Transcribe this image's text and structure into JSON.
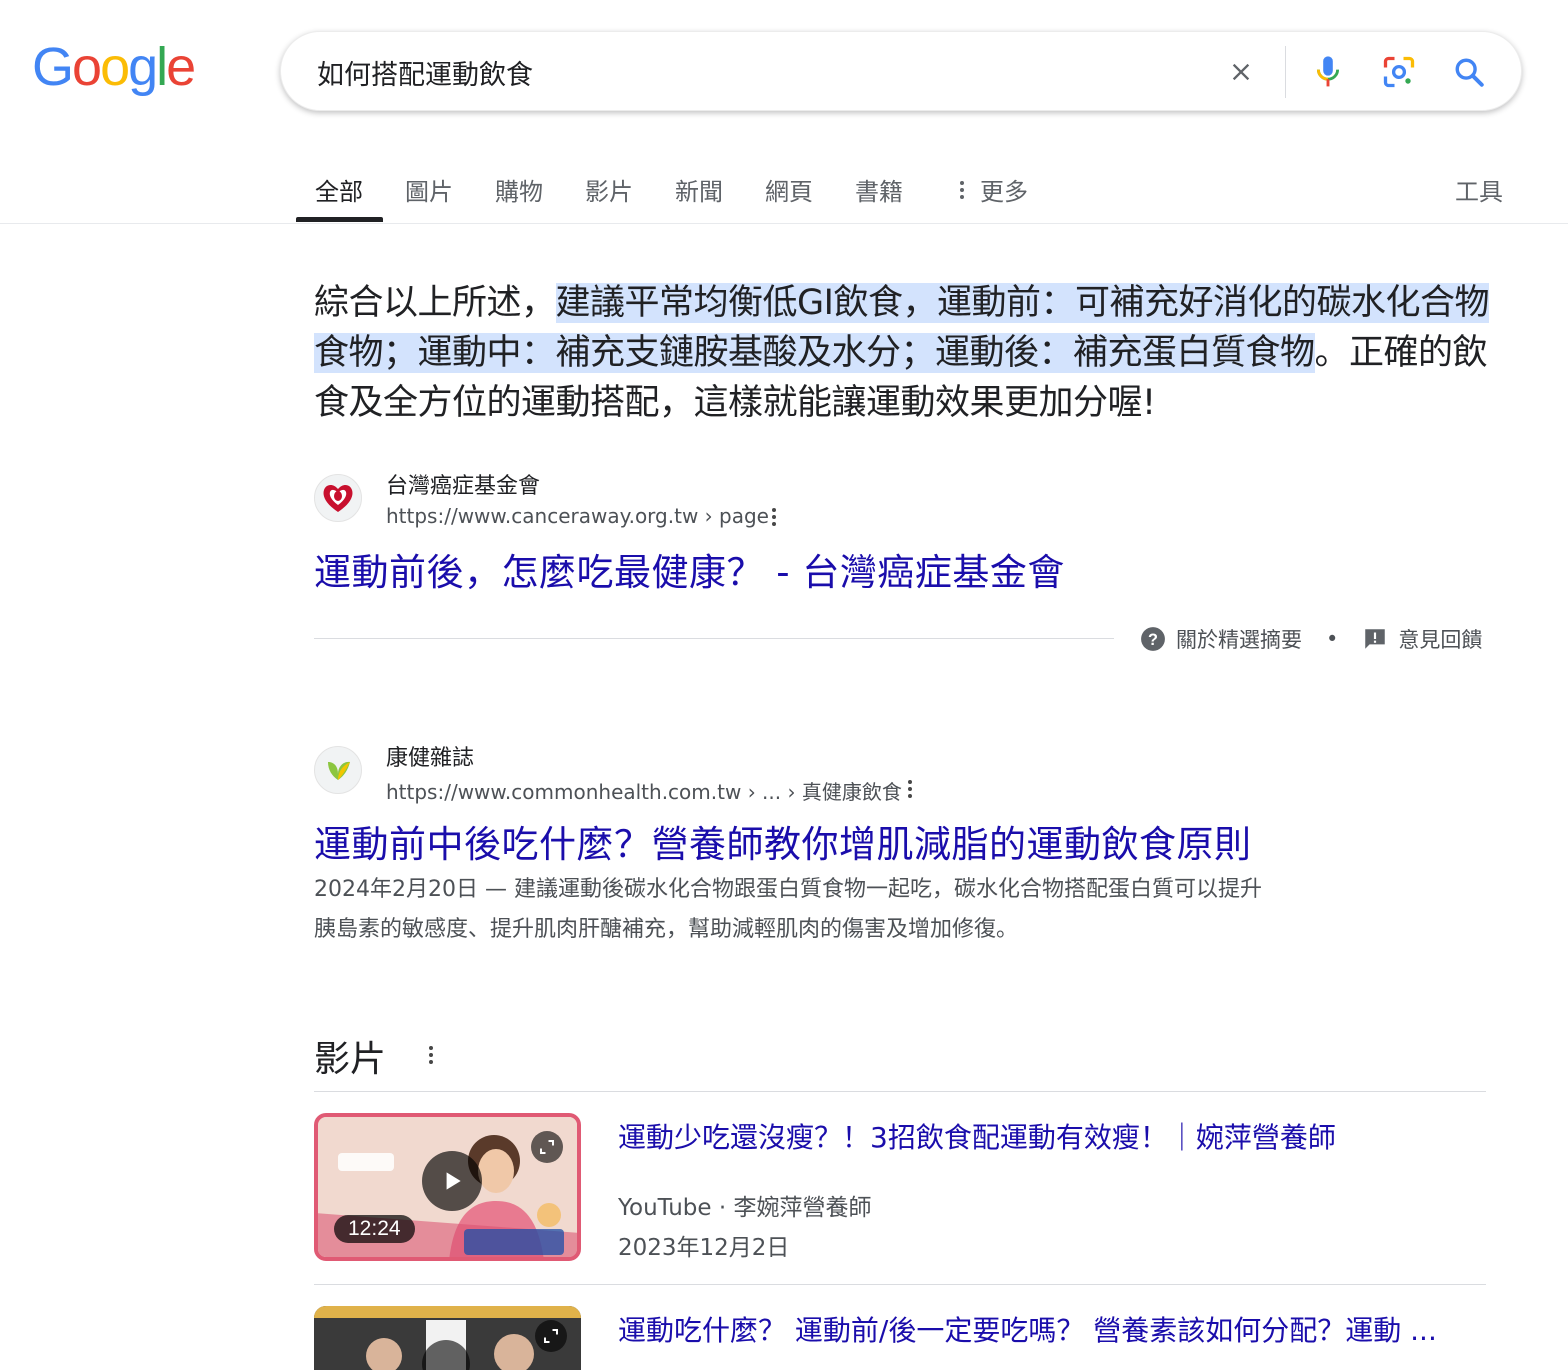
{
  "logo": {
    "letters": [
      "G",
      "o",
      "o",
      "g",
      "l",
      "e"
    ]
  },
  "search": {
    "query": "如何搭配運動飲食"
  },
  "tabs": [
    {
      "label": "全部",
      "active": true
    },
    {
      "label": "圖片"
    },
    {
      "label": "購物"
    },
    {
      "label": "影片"
    },
    {
      "label": "新聞"
    },
    {
      "label": "網頁"
    },
    {
      "label": "書籍"
    },
    {
      "label": "更多"
    }
  ],
  "tools_label": "工具",
  "featured_snippet": {
    "text_before": "綜合以上所述，",
    "text_highlighted": "建議平常均衡低GI飲食，運動前：可補充好消化的碳水化合物食物；運動中：補充支鏈胺基酸及水分；運動後：補充蛋白質食物",
    "text_after": "。正確的飲食及全方位的運動搭配，這樣就能讓運動效果更加分喔!",
    "source_name": "台灣癌症基金會",
    "source_url": "https://www.canceraway.org.tw › page",
    "title": "運動前後，怎麼吃最健康？ - 台灣癌症基金會",
    "about_label": "關於精選摘要",
    "feedback_label": "意見回饋",
    "separator": "•"
  },
  "results": [
    {
      "site_name": "康健雜誌",
      "url": "https://www.commonhealth.com.tw › ... › 真健康飲食",
      "title": "運動前中後吃什麼？營養師教你增肌減脂的運動飲食原則",
      "desc_line1": "2024年2月20日 — 建議運動後碳水化合物跟蛋白質食物一起吃，碳水化合物搭配蛋白質可以提升",
      "desc_line2": "胰島素的敏感度、提升肌肉肝醣補充，幫助減輕肌肉的傷害及增加修復。"
    }
  ],
  "videos_section": {
    "heading": "影片",
    "items": [
      {
        "title": "運動少吃還沒瘦？！3招飲食配運動有效瘦！｜婉萍營養師",
        "source": "YouTube · 李婉萍營養師",
        "date": "2023年12月2日",
        "duration": "12:24"
      },
      {
        "title": "運動吃什麼？ 運動前/後一定要吃嗎？ 營養素該如何分配？運動 ..."
      }
    ]
  },
  "colors": {
    "link": "#1a0dab",
    "highlight": "#d3e3fd",
    "text": "#202124",
    "secondary": "#4d5156"
  },
  "icons": [
    "close-icon",
    "microphone-icon",
    "lens-icon",
    "search-icon",
    "more-vert-icon",
    "help-icon",
    "feedback-icon",
    "play-icon",
    "expand-icon"
  ]
}
